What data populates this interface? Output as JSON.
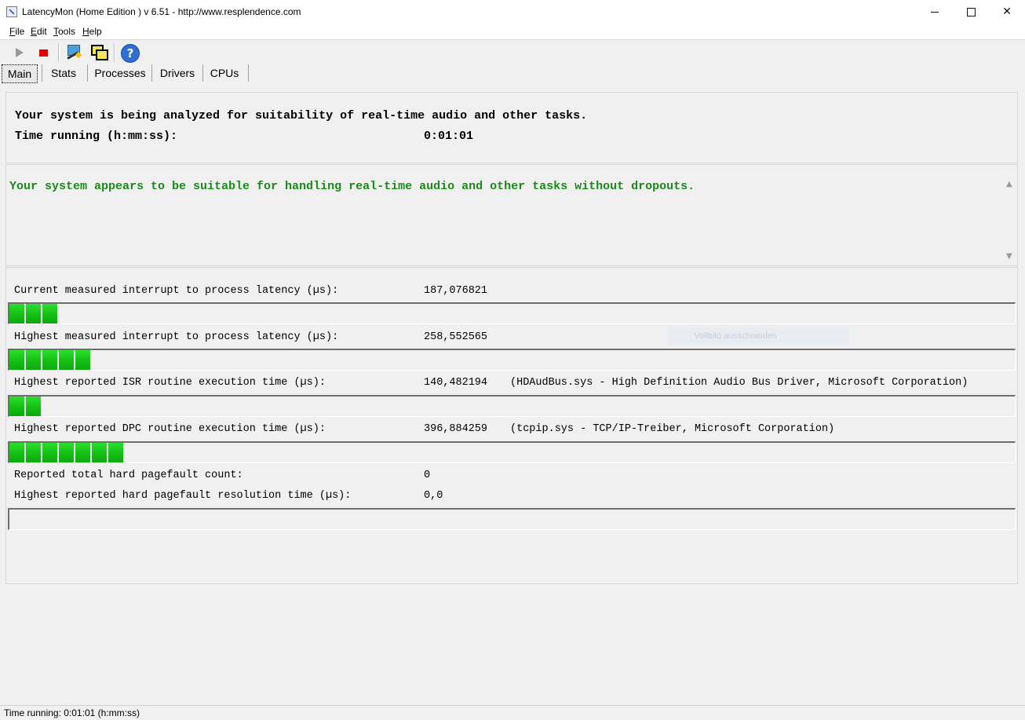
{
  "window": {
    "title": "LatencyMon  (Home Edition )  v 6.51 - http://www.resplendence.com",
    "close_glyph": "✕"
  },
  "menu": {
    "file": {
      "accel": "F",
      "rest": "ile"
    },
    "edit": {
      "accel": "E",
      "rest": "dit"
    },
    "tools": {
      "accel": "T",
      "rest": "ools"
    },
    "help": {
      "accel": "H",
      "rest": "elp"
    }
  },
  "toolbar": {
    "help_glyph": "?"
  },
  "tabs": {
    "main": "Main",
    "stats": "Stats",
    "processes": "Processes",
    "drivers": "Drivers",
    "cpus": "CPUs"
  },
  "header": {
    "analysis_text": "Your system is being analyzed for suitability of real-time audio and other tasks.",
    "time_label": "Time running (h:mm:ss):",
    "time_value": "0:01:01"
  },
  "verdict": {
    "text": "Your system appears to be suitable for handling real-time audio and other tasks without dropouts.",
    "color": "#1a8a1a"
  },
  "scroll": {
    "up_glyph": "▲",
    "down_glyph": "▼"
  },
  "metrics": {
    "current_latency": {
      "label": "Current measured interrupt to process latency (µs):",
      "value": "187,076821",
      "segments": 3
    },
    "highest_latency": {
      "label": "Highest measured interrupt to process latency (µs):",
      "value": "258,552565",
      "segments": 5
    },
    "isr": {
      "label": "Highest reported ISR routine execution time (µs):",
      "value": "140,482194",
      "detail": "(HDAudBus.sys - High Definition Audio Bus Driver, Microsoft Corporation)",
      "segments": 2
    },
    "dpc": {
      "label": "Highest reported DPC routine execution time (µs):",
      "value": "396,884259",
      "detail": "(tcpip.sys - TCP/IP-Treiber, Microsoft Corporation)",
      "segments": 7
    },
    "pagefault_count": {
      "label": "Reported total hard pagefault count:",
      "value": "0"
    },
    "pagefault_time": {
      "label": "Highest reported hard pagefault resolution time (µs):",
      "value": "0,0",
      "segments": 0
    }
  },
  "watermark": "Vollbild ausschneiden",
  "statusbar": {
    "text": "Time running: 0:01:01  (h:mm:ss)"
  },
  "colors": {
    "bar_green": "#15c015",
    "stop_red": "#e00000"
  }
}
